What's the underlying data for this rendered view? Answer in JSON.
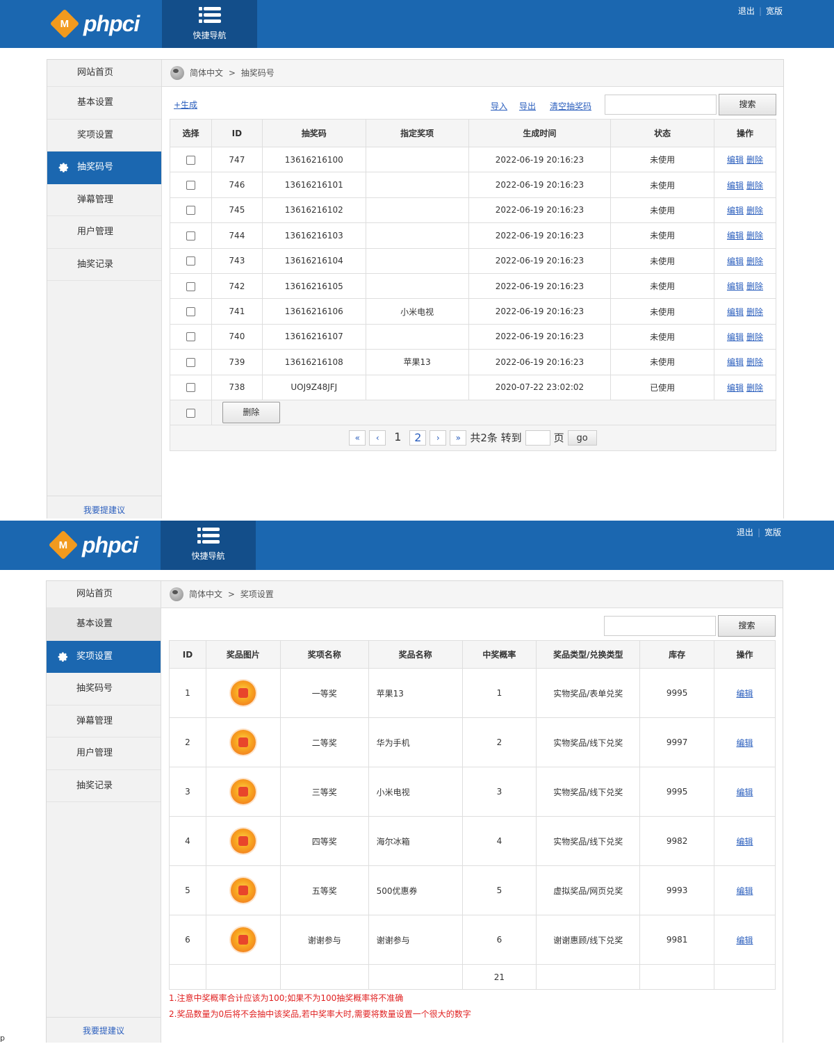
{
  "header": {
    "logo_badge": "M",
    "logo_text": "phpci",
    "quick_nav_label": "快捷导航",
    "logout_label": "退出",
    "wide_label": "宽版",
    "brand_color": "#1b67b0"
  },
  "sidebar_items": [
    "网站首页",
    "基本设置",
    "奖项设置",
    "抽奖码号",
    "弹幕管理",
    "用户管理",
    "抽奖记录"
  ],
  "suggest_label": "我要提建议",
  "panel1": {
    "crumb": {
      "lang": "简体中文",
      "arrow": ">",
      "page": "抽奖码号"
    },
    "active_item": "抽奖码号",
    "generate_link": "+生成",
    "import_link": "导入",
    "export_link": "导出",
    "clear_link": "清空抽奖码",
    "search_button": "搜索",
    "columns": [
      "选择",
      "ID",
      "抽奖码",
      "指定奖项",
      "生成时间",
      "状态",
      "操作"
    ],
    "rows": [
      {
        "id": "747",
        "code": "13616216100",
        "prize": "",
        "time": "2022-06-19 20:16:23",
        "status": "未使用"
      },
      {
        "id": "746",
        "code": "13616216101",
        "prize": "",
        "time": "2022-06-19 20:16:23",
        "status": "未使用"
      },
      {
        "id": "745",
        "code": "13616216102",
        "prize": "",
        "time": "2022-06-19 20:16:23",
        "status": "未使用"
      },
      {
        "id": "744",
        "code": "13616216103",
        "prize": "",
        "time": "2022-06-19 20:16:23",
        "status": "未使用"
      },
      {
        "id": "743",
        "code": "13616216104",
        "prize": "",
        "time": "2022-06-19 20:16:23",
        "status": "未使用"
      },
      {
        "id": "742",
        "code": "13616216105",
        "prize": "",
        "time": "2022-06-19 20:16:23",
        "status": "未使用"
      },
      {
        "id": "741",
        "code": "13616216106",
        "prize": "小米电视",
        "time": "2022-06-19 20:16:23",
        "status": "未使用"
      },
      {
        "id": "740",
        "code": "13616216107",
        "prize": "",
        "time": "2022-06-19 20:16:23",
        "status": "未使用"
      },
      {
        "id": "739",
        "code": "13616216108",
        "prize": "苹果13",
        "time": "2022-06-19 20:16:23",
        "status": "未使用"
      },
      {
        "id": "738",
        "code": "UOJ9Z48JFJ",
        "prize": "",
        "time": "2020-07-22 23:02:02",
        "status": "已使用"
      }
    ],
    "edit_label": "编辑",
    "delete_label": "删除",
    "bulk_delete_button": "删除",
    "pager": {
      "first": "«",
      "prev": "‹",
      "pages": [
        "1",
        "2"
      ],
      "current_page": "2",
      "next": "›",
      "last": "»",
      "total_text": "共2条 转到",
      "page_unit": "页",
      "go_label": "go"
    }
  },
  "panel2": {
    "crumb": {
      "lang": "简体中文",
      "arrow": ">",
      "page": "奖项设置"
    },
    "active_item": "奖项设置",
    "search_button": "搜索",
    "columns": [
      "ID",
      "奖品图片",
      "奖项名称",
      "奖品名称",
      "中奖概率",
      "奖品类型/兑换类型",
      "库存",
      "操作"
    ],
    "rows": [
      {
        "id": "1",
        "level": "一等奖",
        "name": "苹果13",
        "prob": "1",
        "type": "实物奖品/表单兑奖",
        "stock": "9995",
        "icon": "red-envelope-icon"
      },
      {
        "id": "2",
        "level": "二等奖",
        "name": "华为手机",
        "prob": "2",
        "type": "实物奖品/线下兑奖",
        "stock": "9997",
        "icon": "flower-icon"
      },
      {
        "id": "3",
        "level": "三等奖",
        "name": "小米电视",
        "prob": "3",
        "type": "实物奖品/线下兑奖",
        "stock": "9995",
        "icon": "yuan-coin-icon"
      },
      {
        "id": "4",
        "level": "四等奖",
        "name": "海尔冰箱",
        "prob": "4",
        "type": "实物奖品/线下兑奖",
        "stock": "9982",
        "icon": "smile-icon"
      },
      {
        "id": "5",
        "level": "五等奖",
        "name": "500优惠券",
        "prob": "5",
        "type": "虚拟奖品/网页兑奖",
        "stock": "9993",
        "icon": "wallet-icon"
      },
      {
        "id": "6",
        "level": "谢谢参与",
        "name": "谢谢参与",
        "prob": "6",
        "type": "谢谢惠顾/线下兑奖",
        "stock": "9981",
        "icon": "koi-fish-icon"
      }
    ],
    "total_prob": "21",
    "edit_label": "编辑",
    "notes": [
      "1.注意中奖概率合计应该为100;如果不为100抽奖概率将不准确",
      "2.奖品数量为0后将不会抽中该奖品,若中奖率大时,需要将数量设置一个很大的数字"
    ],
    "note_color": "#e02020"
  },
  "corner_text": "p"
}
